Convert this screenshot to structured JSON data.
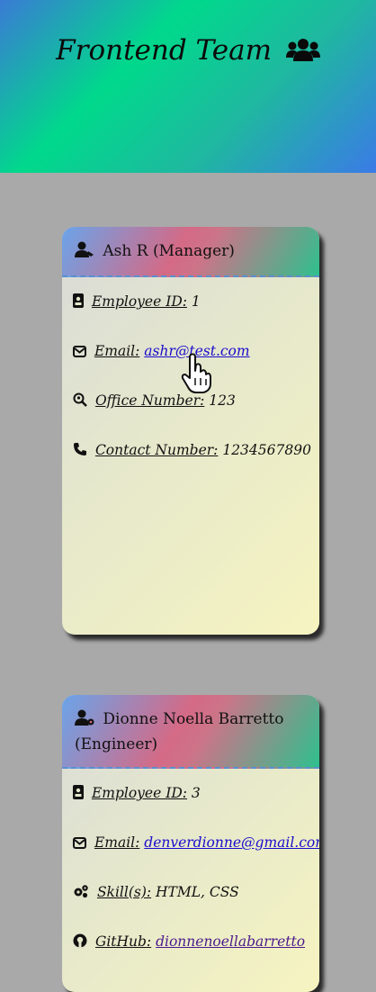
{
  "header": {
    "title": "Frontend Team",
    "icon": "users-icon",
    "gradient": [
      "#3a7bd5",
      "#00d98b",
      "#3a7be6"
    ]
  },
  "cards": [
    {
      "name": "Ash R (Manager)",
      "icon": "user-tie-icon",
      "rows": [
        {
          "icon": "id-badge-icon",
          "label": "Employee ID:",
          "value": "1"
        },
        {
          "icon": "envelope-icon",
          "label": "Email:",
          "value": "ashr@test.com"
        },
        {
          "icon": "search-location-icon",
          "label": "Office Number:",
          "value": "123"
        },
        {
          "icon": "phone-icon",
          "label": "Contact Number:",
          "value": "1234567890"
        }
      ]
    },
    {
      "name_line1": "Dionne Noella Barretto",
      "name_line2": "(Engineer)",
      "icon": "user-cog-icon",
      "rows": [
        {
          "icon": "id-badge-icon",
          "label": "Employee ID:",
          "value": "3"
        },
        {
          "icon": "envelope-icon",
          "label": "Email:",
          "value": "denverdionne@gmail.com"
        },
        {
          "icon": "cogs-icon",
          "label": "Skill(s):",
          "value": "HTML, CSS"
        },
        {
          "icon": "github-icon",
          "label": "GitHub:",
          "value": "dionnenoellabarretto"
        }
      ]
    }
  ],
  "colors": {
    "page_bg": "#a9a9a9",
    "link": "#1a0dcc",
    "visited_link": "#4b1a8c"
  }
}
